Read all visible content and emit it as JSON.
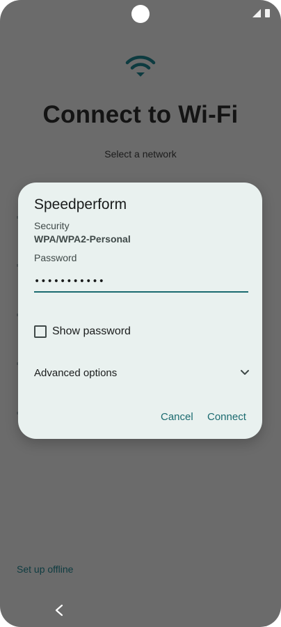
{
  "screen": {
    "title": "Connect to Wi-Fi",
    "subtitle": "Select a network",
    "offline_link": "Set up offline"
  },
  "status_bar": {
    "icons": [
      "signal-icon",
      "battery-icon"
    ]
  },
  "dialog": {
    "network_name": "Speedperform",
    "security_label": "Security",
    "security_value": "WPA/WPA2-Personal",
    "password_label": "Password",
    "password_value": "•••••••••••",
    "show_password_label": "Show password",
    "show_password_checked": false,
    "advanced_options_label": "Advanced options",
    "cancel_label": "Cancel",
    "connect_label": "Connect"
  },
  "colors": {
    "scrim": "#6b6b6b",
    "dialog_bg": "#e9f1ef",
    "accent": "#1a6a6f",
    "wifi_icon": "#0d3b40"
  }
}
